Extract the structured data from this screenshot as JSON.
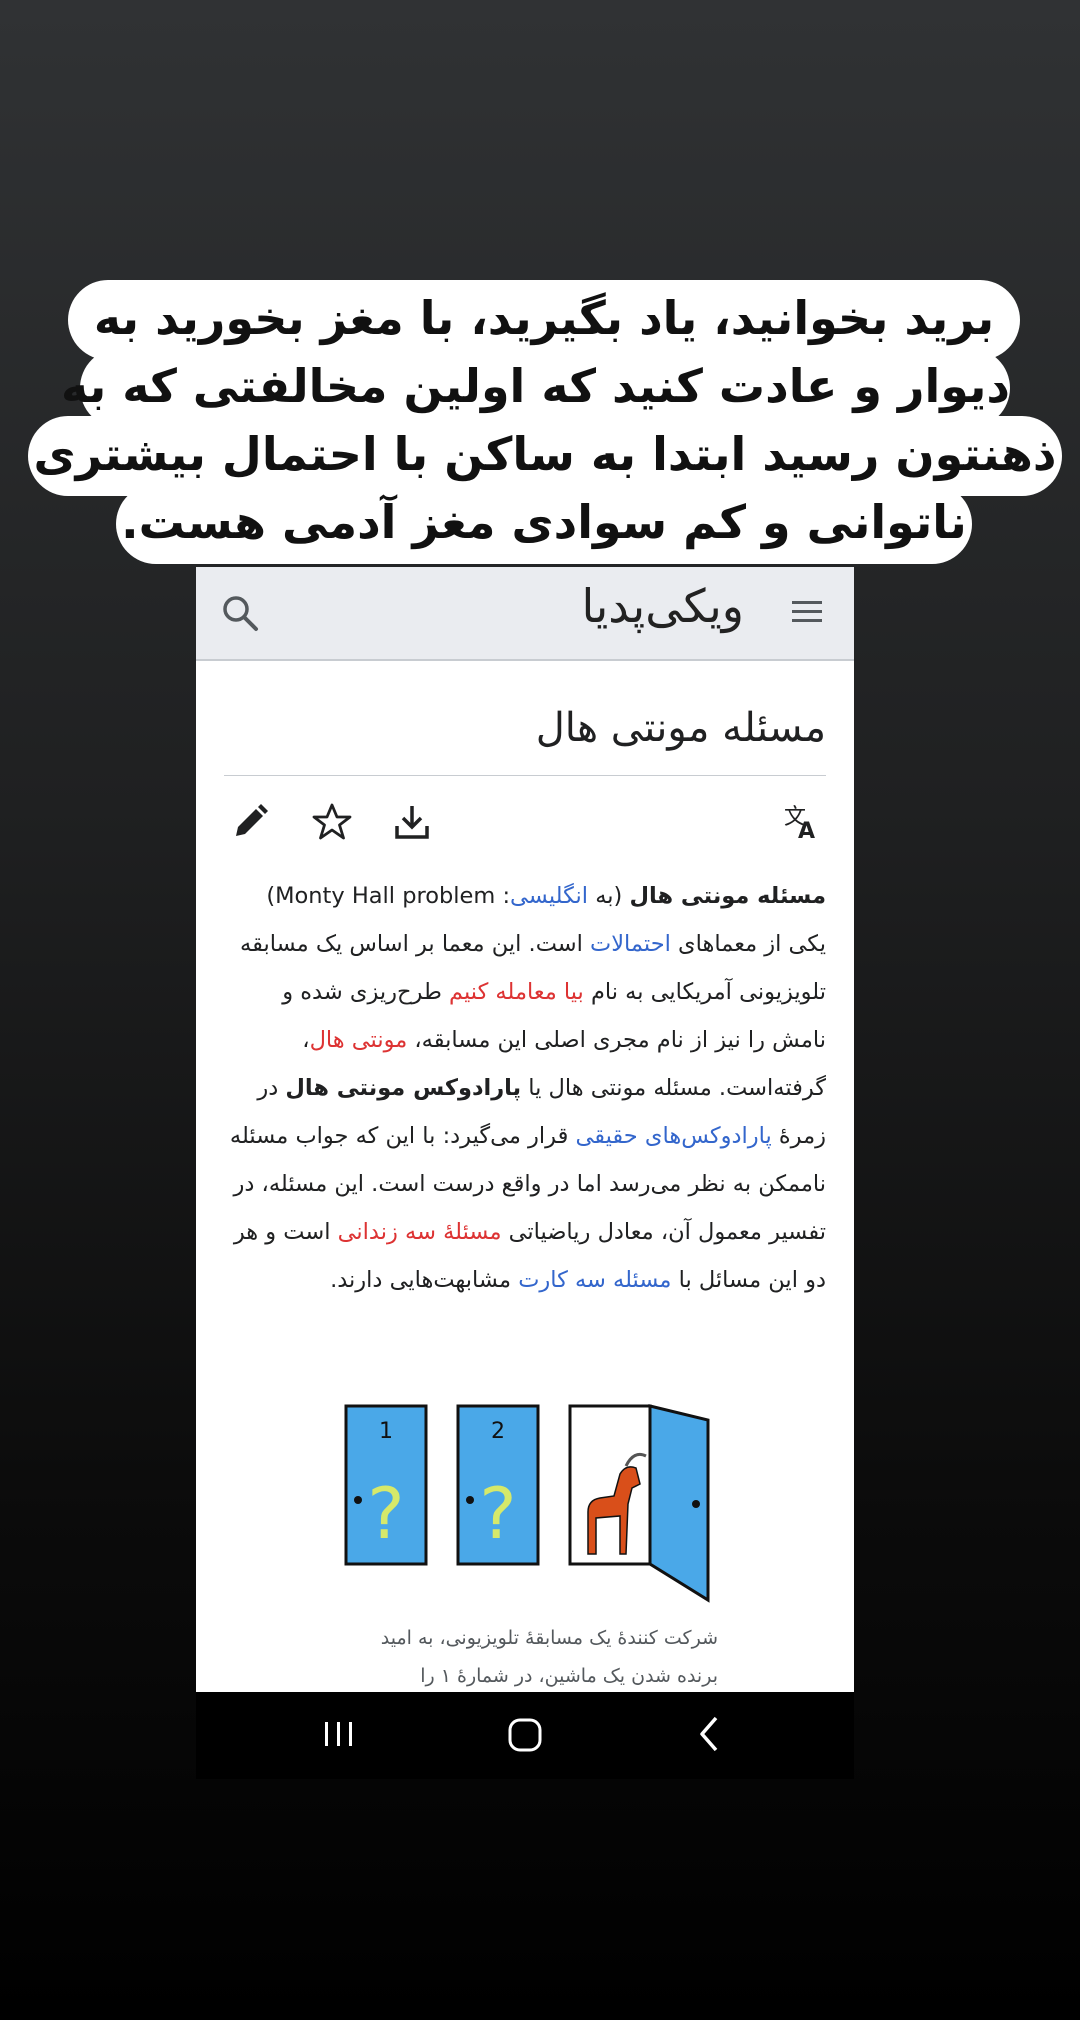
{
  "caption": {
    "lines": [
      "برید بخوانید، یاد بگیرید، با مغز بخورید به",
      "دیوار و عادت کنید که اولین مخالفتی که به",
      "ذهنتون رسید ابتدا به ساکن با احتمال بیشتری",
      "ناتوانی و کم سوادی مغز آدمی هست."
    ]
  },
  "wiki": {
    "site_title": "ویکی‌پدیا",
    "page_title": "مسئله مونتی هال",
    "article": {
      "p1": "مسئله مونتی هال",
      "p2": " (به ",
      "p3": "انگلیسی",
      "p4": ": Monty Hall problem) یکی از معماهای ",
      "p5": "احتمالات",
      "p6": " است. این معما بر اساس یک مسابقه تلویزیونی آمریکایی به نام ",
      "p7": "بیا معامله کنیم",
      "p8": " طرح‌ریزی شده و نامش را نیز از نام مجری اصلی این مسابقه، ",
      "p9": "مونتی هال",
      "p10": "، گرفته‌است. مسئله مونتی هال یا ",
      "p11": "پارادوکس مونتی هال",
      "p12": " در زمرهٔ ",
      "p13": "پارادوکس‌های حقیقی",
      "p14": " قرار می‌گیرد: با این که جواب مسئله ناممکن به نظر می‌رسد اما در واقع درست است. این مسئله، در تفسیر معمول آن، معادل ریاضیاتی ",
      "p15": "مسئلهٔ سه زندانی",
      "p16": " است و هر دو این مسائل با ",
      "p17": "مسئله سه کارت",
      "p18": " مشابهت‌هایی دارند."
    },
    "figure": {
      "door1_number": "1",
      "door2_number": "2",
      "door_mark": "?",
      "caption_line1": "شرکت کنندهٔ یک مسابقهٔ تلویزیونی، به امید",
      "caption_line2": "برنده شدن یک ماشین، در شمارهٔ ۱ را"
    }
  },
  "colors": {
    "link": "#3366cc",
    "redlink": "#dd3333",
    "door": "#4aa8e8",
    "goat": "#d94f1a"
  },
  "icons": [
    "menu-icon",
    "search-icon",
    "edit-icon",
    "star-icon",
    "download-icon",
    "translate-icon",
    "recent-apps-icon",
    "home-icon",
    "back-icon"
  ]
}
